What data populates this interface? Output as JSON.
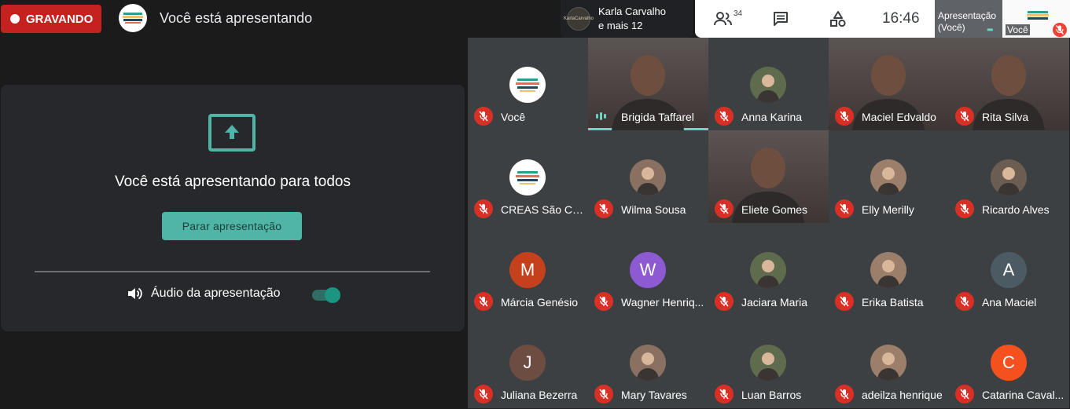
{
  "recording": {
    "label": "GRAVANDO"
  },
  "header": {
    "presenting_title": "Você está apresentando"
  },
  "speaker": {
    "line1": "Karla Carvalho",
    "line2": "e mais 12",
    "avatar_text": "KarlaCarvalho"
  },
  "controls": {
    "people_count": "34",
    "people_icon": "people-icon",
    "chat_icon": "chat-icon",
    "activities_icon": "activities-icon",
    "clock": "16:46"
  },
  "self_view": {
    "presentation_label_1": "Apresentação",
    "presentation_label_2": "(Você)",
    "name": "Você"
  },
  "panel": {
    "title": "Você está apresentando para todos",
    "stop_button": "Parar apresentação",
    "audio_label": "Áudio da apresentação",
    "audio_enabled": true
  },
  "colors": {
    "accent": "#4eb5a7",
    "recording": "#c5221f",
    "muted": "#d93025",
    "speaking": "#6ad5c5"
  },
  "participants": [
    {
      "name": "Você",
      "kind": "logo"
    },
    {
      "name": "Brigida Taffarel",
      "kind": "video",
      "speaking": true
    },
    {
      "name": "Anna Karina",
      "kind": "photo"
    },
    {
      "name": "Maciel Edvaldo",
      "kind": "video"
    },
    {
      "name": "Rita Silva",
      "kind": "video"
    },
    {
      "name": "CREAS São Ca...",
      "kind": "logo"
    },
    {
      "name": "Wilma Sousa",
      "kind": "photo"
    },
    {
      "name": "Eliete Gomes",
      "kind": "video"
    },
    {
      "name": "Elly Merilly",
      "kind": "photo"
    },
    {
      "name": "Ricardo Alves",
      "kind": "photo"
    },
    {
      "name": "Márcia Genésio",
      "kind": "initial",
      "initial": "M",
      "color": "#c5411c"
    },
    {
      "name": "Wagner Henriq...",
      "kind": "initial",
      "initial": "W",
      "color": "#8e5ad4"
    },
    {
      "name": "Jaciara Maria",
      "kind": "photo"
    },
    {
      "name": "Erika Batista",
      "kind": "photo"
    },
    {
      "name": "Ana Maciel",
      "kind": "initial",
      "initial": "A",
      "color": "#4b5a63"
    },
    {
      "name": "Juliana Bezerra",
      "kind": "initial",
      "initial": "J",
      "color": "#6d4c41"
    },
    {
      "name": "Mary Tavares",
      "kind": "photo"
    },
    {
      "name": "Luan Barros",
      "kind": "photo"
    },
    {
      "name": "adeilza henrique",
      "kind": "photo"
    },
    {
      "name": "Catarina Caval...",
      "kind": "initial",
      "initial": "C",
      "color": "#f4511e"
    }
  ]
}
